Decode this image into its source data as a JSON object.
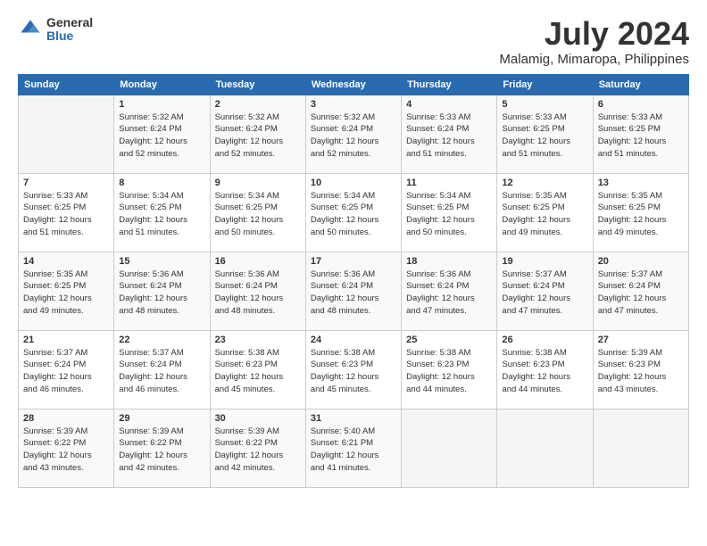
{
  "header": {
    "logo_general": "General",
    "logo_blue": "Blue",
    "title": "July 2024",
    "subtitle": "Malamig, Mimaropa, Philippines"
  },
  "days_of_week": [
    "Sunday",
    "Monday",
    "Tuesday",
    "Wednesday",
    "Thursday",
    "Friday",
    "Saturday"
  ],
  "weeks": [
    [
      {
        "day": "",
        "sunrise": "",
        "sunset": "",
        "daylight": ""
      },
      {
        "day": "1",
        "sunrise": "Sunrise: 5:32 AM",
        "sunset": "Sunset: 6:24 PM",
        "daylight": "Daylight: 12 hours and 52 minutes."
      },
      {
        "day": "2",
        "sunrise": "Sunrise: 5:32 AM",
        "sunset": "Sunset: 6:24 PM",
        "daylight": "Daylight: 12 hours and 52 minutes."
      },
      {
        "day": "3",
        "sunrise": "Sunrise: 5:32 AM",
        "sunset": "Sunset: 6:24 PM",
        "daylight": "Daylight: 12 hours and 52 minutes."
      },
      {
        "day": "4",
        "sunrise": "Sunrise: 5:33 AM",
        "sunset": "Sunset: 6:24 PM",
        "daylight": "Daylight: 12 hours and 51 minutes."
      },
      {
        "day": "5",
        "sunrise": "Sunrise: 5:33 AM",
        "sunset": "Sunset: 6:25 PM",
        "daylight": "Daylight: 12 hours and 51 minutes."
      },
      {
        "day": "6",
        "sunrise": "Sunrise: 5:33 AM",
        "sunset": "Sunset: 6:25 PM",
        "daylight": "Daylight: 12 hours and 51 minutes."
      }
    ],
    [
      {
        "day": "7",
        "sunrise": "Sunrise: 5:33 AM",
        "sunset": "Sunset: 6:25 PM",
        "daylight": "Daylight: 12 hours and 51 minutes."
      },
      {
        "day": "8",
        "sunrise": "Sunrise: 5:34 AM",
        "sunset": "Sunset: 6:25 PM",
        "daylight": "Daylight: 12 hours and 51 minutes."
      },
      {
        "day": "9",
        "sunrise": "Sunrise: 5:34 AM",
        "sunset": "Sunset: 6:25 PM",
        "daylight": "Daylight: 12 hours and 50 minutes."
      },
      {
        "day": "10",
        "sunrise": "Sunrise: 5:34 AM",
        "sunset": "Sunset: 6:25 PM",
        "daylight": "Daylight: 12 hours and 50 minutes."
      },
      {
        "day": "11",
        "sunrise": "Sunrise: 5:34 AM",
        "sunset": "Sunset: 6:25 PM",
        "daylight": "Daylight: 12 hours and 50 minutes."
      },
      {
        "day": "12",
        "sunrise": "Sunrise: 5:35 AM",
        "sunset": "Sunset: 6:25 PM",
        "daylight": "Daylight: 12 hours and 49 minutes."
      },
      {
        "day": "13",
        "sunrise": "Sunrise: 5:35 AM",
        "sunset": "Sunset: 6:25 PM",
        "daylight": "Daylight: 12 hours and 49 minutes."
      }
    ],
    [
      {
        "day": "14",
        "sunrise": "Sunrise: 5:35 AM",
        "sunset": "Sunset: 6:25 PM",
        "daylight": "Daylight: 12 hours and 49 minutes."
      },
      {
        "day": "15",
        "sunrise": "Sunrise: 5:36 AM",
        "sunset": "Sunset: 6:24 PM",
        "daylight": "Daylight: 12 hours and 48 minutes."
      },
      {
        "day": "16",
        "sunrise": "Sunrise: 5:36 AM",
        "sunset": "Sunset: 6:24 PM",
        "daylight": "Daylight: 12 hours and 48 minutes."
      },
      {
        "day": "17",
        "sunrise": "Sunrise: 5:36 AM",
        "sunset": "Sunset: 6:24 PM",
        "daylight": "Daylight: 12 hours and 48 minutes."
      },
      {
        "day": "18",
        "sunrise": "Sunrise: 5:36 AM",
        "sunset": "Sunset: 6:24 PM",
        "daylight": "Daylight: 12 hours and 47 minutes."
      },
      {
        "day": "19",
        "sunrise": "Sunrise: 5:37 AM",
        "sunset": "Sunset: 6:24 PM",
        "daylight": "Daylight: 12 hours and 47 minutes."
      },
      {
        "day": "20",
        "sunrise": "Sunrise: 5:37 AM",
        "sunset": "Sunset: 6:24 PM",
        "daylight": "Daylight: 12 hours and 47 minutes."
      }
    ],
    [
      {
        "day": "21",
        "sunrise": "Sunrise: 5:37 AM",
        "sunset": "Sunset: 6:24 PM",
        "daylight": "Daylight: 12 hours and 46 minutes."
      },
      {
        "day": "22",
        "sunrise": "Sunrise: 5:37 AM",
        "sunset": "Sunset: 6:24 PM",
        "daylight": "Daylight: 12 hours and 46 minutes."
      },
      {
        "day": "23",
        "sunrise": "Sunrise: 5:38 AM",
        "sunset": "Sunset: 6:23 PM",
        "daylight": "Daylight: 12 hours and 45 minutes."
      },
      {
        "day": "24",
        "sunrise": "Sunrise: 5:38 AM",
        "sunset": "Sunset: 6:23 PM",
        "daylight": "Daylight: 12 hours and 45 minutes."
      },
      {
        "day": "25",
        "sunrise": "Sunrise: 5:38 AM",
        "sunset": "Sunset: 6:23 PM",
        "daylight": "Daylight: 12 hours and 44 minutes."
      },
      {
        "day": "26",
        "sunrise": "Sunrise: 5:38 AM",
        "sunset": "Sunset: 6:23 PM",
        "daylight": "Daylight: 12 hours and 44 minutes."
      },
      {
        "day": "27",
        "sunrise": "Sunrise: 5:39 AM",
        "sunset": "Sunset: 6:23 PM",
        "daylight": "Daylight: 12 hours and 43 minutes."
      }
    ],
    [
      {
        "day": "28",
        "sunrise": "Sunrise: 5:39 AM",
        "sunset": "Sunset: 6:22 PM",
        "daylight": "Daylight: 12 hours and 43 minutes."
      },
      {
        "day": "29",
        "sunrise": "Sunrise: 5:39 AM",
        "sunset": "Sunset: 6:22 PM",
        "daylight": "Daylight: 12 hours and 42 minutes."
      },
      {
        "day": "30",
        "sunrise": "Sunrise: 5:39 AM",
        "sunset": "Sunset: 6:22 PM",
        "daylight": "Daylight: 12 hours and 42 minutes."
      },
      {
        "day": "31",
        "sunrise": "Sunrise: 5:40 AM",
        "sunset": "Sunset: 6:21 PM",
        "daylight": "Daylight: 12 hours and 41 minutes."
      },
      {
        "day": "",
        "sunrise": "",
        "sunset": "",
        "daylight": ""
      },
      {
        "day": "",
        "sunrise": "",
        "sunset": "",
        "daylight": ""
      },
      {
        "day": "",
        "sunrise": "",
        "sunset": "",
        "daylight": ""
      }
    ]
  ]
}
